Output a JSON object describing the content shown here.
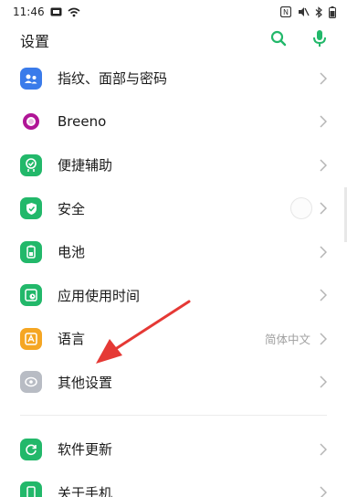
{
  "status_bar": {
    "time": "11:46"
  },
  "header": {
    "title": "设置"
  },
  "settings": {
    "items": [
      {
        "label": "指纹、面部与密码",
        "icon": "fingerprint-face-icon",
        "color": "#3a7bea"
      },
      {
        "label": "Breeno",
        "icon": "breeno-icon",
        "color": "#b01596"
      },
      {
        "label": "便捷辅助",
        "icon": "assist-icon",
        "color": "#22b86a"
      },
      {
        "label": "安全",
        "icon": "shield-icon",
        "color": "#22b86a"
      },
      {
        "label": "电池",
        "icon": "battery-icon",
        "color": "#22b86a"
      },
      {
        "label": "应用使用时间",
        "icon": "app-usage-icon",
        "color": "#22b86a"
      },
      {
        "label": "语言",
        "icon": "language-icon",
        "color": "#f5a623",
        "value": "简体中文"
      },
      {
        "label": "其他设置",
        "icon": "other-settings-icon",
        "color": "#b8bcc4"
      },
      {
        "label": "软件更新",
        "icon": "update-icon",
        "color": "#22b86a"
      },
      {
        "label": "关于手机",
        "icon": "about-phone-icon",
        "color": "#22b86a"
      }
    ]
  },
  "colors": {
    "accent": "#22b86a",
    "annotation_arrow": "#e53935"
  }
}
